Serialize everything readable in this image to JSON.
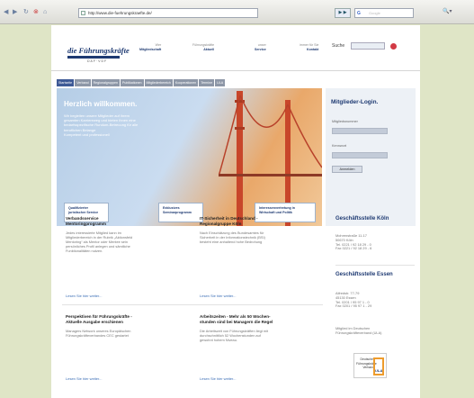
{
  "browser": {
    "nav_buttons": [
      "back",
      "forward",
      "reload",
      "stop",
      "home"
    ],
    "url": "http://www.die-fuehrungskraefte.de/",
    "go_label": "▶ ▶",
    "search_placeholder": "Google"
  },
  "site": {
    "logo_text": "die Führungskräfte",
    "logo_sub": "DAF·VDF",
    "nav": [
      {
        "small": "Wer",
        "big": "Mitgliedschaft"
      },
      {
        "small": "Führungskräfte",
        "big": "Aktuell"
      },
      {
        "small": "unser",
        "big": "Service"
      },
      {
        "small": "immer für Sie",
        "big": "Kontakt"
      }
    ],
    "search_label": "Suche"
  },
  "tabs": [
    "Startseite",
    "Verband",
    "Regionalgruppen",
    "Publikationen",
    "Mitgliederbereich",
    "Kooperationen",
    "Termine",
    "ULA"
  ],
  "welcome": {
    "title": "Herzlich willkommen.",
    "lines": [
      "Wir begleiten unsere Mitglieder auf ihrem",
      "gesamten Karriereweg und bieten Ihnen eine",
      "bedarfsspezifische Rundum-Betreuung für alle",
      "beruflichen Belange",
      "Kompetent und professionell"
    ],
    "promos": [
      {
        "line1": "Qualifizierter",
        "line2": "juristischer Service"
      },
      {
        "line1": "Exklusives",
        "line2": "Seminarprogramm"
      },
      {
        "line1": "Interessenvertretung in",
        "line2": "Wirtschaft und Politik"
      }
    ]
  },
  "login": {
    "title": "Mitglieder-Login.",
    "member_label": "Mitgliedsnummer",
    "password_label": "Kennwort",
    "submit_label": "Anmelden"
  },
  "articles": [
    {
      "title": [
        "Verbandsservice",
        "Mentoringprogramm"
      ],
      "body": [
        "Jedes interessierte Mitglied kann im",
        "Mitgliederbereich in der Rubrik „Aktionsfeld",
        "Mentoring“ als Mentor oder Mentee sein",
        "persönliches Profil anlegen und sämtliche",
        "Funktionalitäten nutzen."
      ],
      "more": "Lesen Sie hier weiter..."
    },
    {
      "title": [
        "IT-Sicherheit in Deutschland -",
        "Regionalgruppe Köln"
      ],
      "body": [
        "Nach Einschätzung des Bundesamtes für",
        "Sicherheit in der Informationstechnik (BSI)",
        "besteht eine anhaltend hohe Bedrohung"
      ],
      "more": "Lesen Sie hier weiter..."
    },
    {
      "title": [
        "Perspektiven für Führungskräfte -",
        "Aktuelle Ausgabe erschienen"
      ],
      "body": [
        "Managers Network unseres Europäischen",
        "Führungskräfteverbandes CEC gestartet"
      ],
      "more": "Lesen Sie hier weiter..."
    },
    {
      "title": [
        "Arbeitszeiten - Mehr als 50 Wochen-",
        "stunden sind bei Managern die Regel"
      ],
      "body": [
        "Die Arbeitszeit von Führungskräften liegt mit",
        "durchschnittlich 52 Wochenstunden auf",
        "gewohnt hohem Niveau."
      ],
      "more": "Lesen Sie hier weiter..."
    }
  ],
  "offices": [
    {
      "title": "Geschäftsstelle Köln",
      "lines": [
        "Mohrenstraße 11-17",
        "50670 Köln",
        "Tel. 0221 / 92 18 29 - 0",
        "Fax 0221 / 92 18 29 - 6"
      ]
    },
    {
      "title": "Geschäftsstelle Essen",
      "lines": [
        "Alfredstr. 77-79",
        "45130 Essen",
        "Tel. 0201 / 95 97 1 - 0",
        "Fax 0201 / 95 97 1 - 29"
      ]
    }
  ],
  "ula": {
    "caption": [
      "Mitglied im Deutschen",
      "Führungskräfteverband (ULA)"
    ],
    "logo_lines": [
      "Deutscher",
      "Führungskräfte",
      "Verband"
    ],
    "logo_mark": "ULA"
  }
}
